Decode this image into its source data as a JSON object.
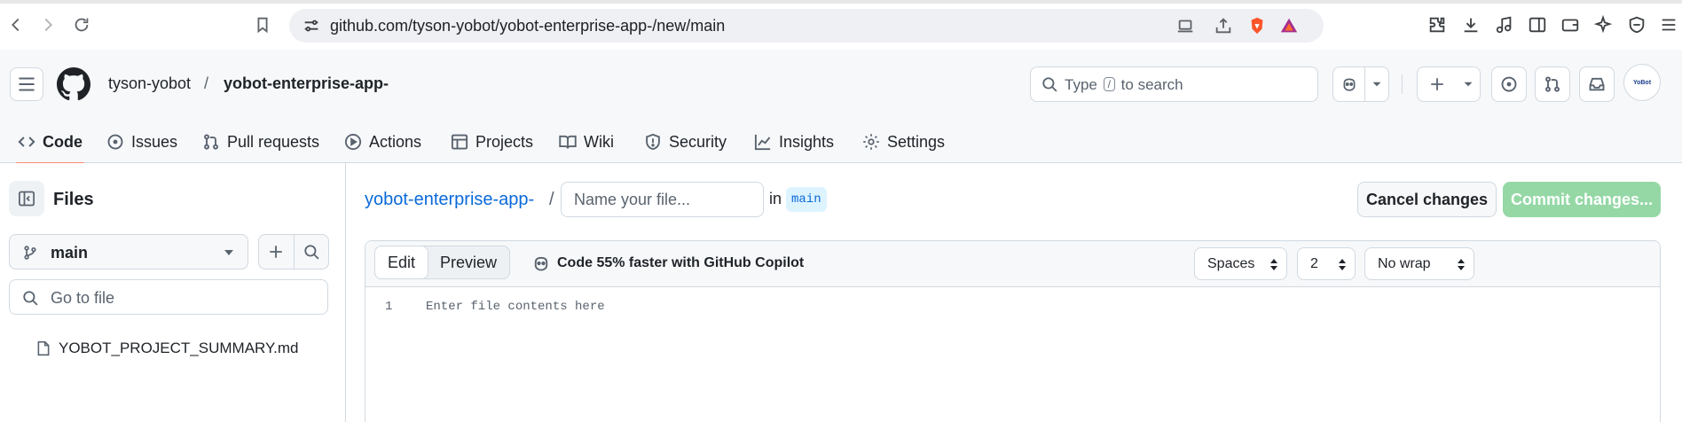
{
  "browser": {
    "url": "github.com/tyson-yobot/yobot-enterprise-app-/new/main",
    "nav": {
      "back_icon": "arrow-left-icon",
      "forward_icon": "arrow-right-icon",
      "reload_icon": "reload-icon"
    }
  },
  "header": {
    "owner": "tyson-yobot",
    "separator": "/",
    "repo": "yobot-enterprise-app-",
    "search": {
      "before": "Type",
      "key": "/",
      "after": "to search"
    },
    "avatar_label": "YoBot"
  },
  "tabs": [
    {
      "label": "Code",
      "icon": "code-icon",
      "active": true
    },
    {
      "label": "Issues",
      "icon": "issue-icon",
      "active": false
    },
    {
      "label": "Pull requests",
      "icon": "pull-request-icon",
      "active": false
    },
    {
      "label": "Actions",
      "icon": "play-icon",
      "active": false
    },
    {
      "label": "Projects",
      "icon": "table-icon",
      "active": false
    },
    {
      "label": "Wiki",
      "icon": "book-icon",
      "active": false
    },
    {
      "label": "Security",
      "icon": "shield-icon",
      "active": false
    },
    {
      "label": "Insights",
      "icon": "graph-icon",
      "active": false
    },
    {
      "label": "Settings",
      "icon": "gear-icon",
      "active": false
    }
  ],
  "sidebar": {
    "title": "Files",
    "branch": "main",
    "goto_placeholder": "Go to file",
    "files": [
      {
        "name": "YOBOT_PROJECT_SUMMARY.md",
        "icon": "file-icon"
      }
    ]
  },
  "editor": {
    "path_repo": "yobot-enterprise-app-",
    "path_sep": "/",
    "filename_placeholder": "Name your file...",
    "in_label": "in",
    "branch": "main",
    "cancel_label": "Cancel changes",
    "commit_label": "Commit changes...",
    "mode_edit": "Edit",
    "mode_preview": "Preview",
    "copilot_text": "Code 55% faster with GitHub Copilot",
    "indent_mode": "Spaces",
    "indent_size": "2",
    "wrap_mode": "No wrap",
    "line_number": "1",
    "content_placeholder": "Enter file contents here"
  },
  "colors": {
    "accent_link": "#0969da",
    "active_tab_underline": "#fd8c73",
    "commit_button_disabled": "#95d8a6",
    "branch_chip_bg": "#ddf4ff"
  }
}
